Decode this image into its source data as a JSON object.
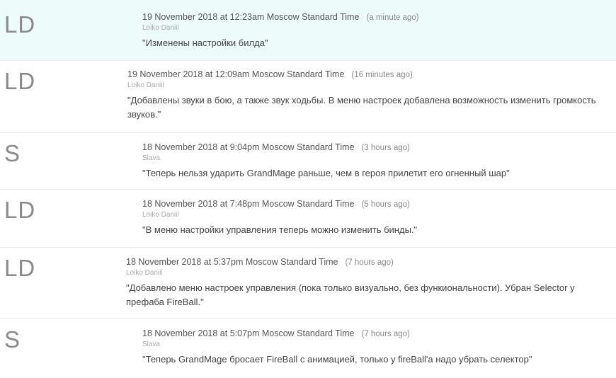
{
  "commits": [
    {
      "avatar": "LD",
      "date": "19 November 2018 at 12:23am Moscow Standard Time",
      "ago": "(a minute ago)",
      "author": "Loiko Daniil",
      "message": "\"Изменены настройки билда\""
    },
    {
      "avatar": "LD",
      "date": "19 November 2018 at 12:09am Moscow Standard Time",
      "ago": "(16 minutes ago)",
      "author": "Loiko Daniil",
      "message": "\"Добавлены звуки в бою, а также звук ходьбы. В меню настроек добавлена возможность изменить громкость звуков.\""
    },
    {
      "avatar": "S",
      "date": "18 November 2018 at 9:04pm Moscow Standard Time",
      "ago": "(3 hours ago)",
      "author": "Slava",
      "message": "\"Теперь нельзя ударить GrandMage раньше, чем в героя прилетит его огненный шар\""
    },
    {
      "avatar": "LD",
      "date": "18 November 2018 at 7:48pm Moscow Standard Time",
      "ago": "(5 hours ago)",
      "author": "Loiko Daniil",
      "message": "\"В меню настройки управления теперь можно изменить бинды.\""
    },
    {
      "avatar": "LD",
      "date": "18 November 2018 at 5:37pm Moscow Standard Time",
      "ago": "(7 hours ago)",
      "author": "Loiko Daniil",
      "message": "\"Добавлено меню настроек управления (пока только визуально, без функиональности). Убран Selector у префаба FireBall.\""
    },
    {
      "avatar": "S",
      "date": "18 November 2018 at 5:07pm Moscow Standard Time",
      "ago": "(7 hours ago)",
      "author": "Slava",
      "message": "\"Теперь GrandMage бросает FireBall с анимацией, только у fireBall'a надо убрать селектор\""
    }
  ]
}
